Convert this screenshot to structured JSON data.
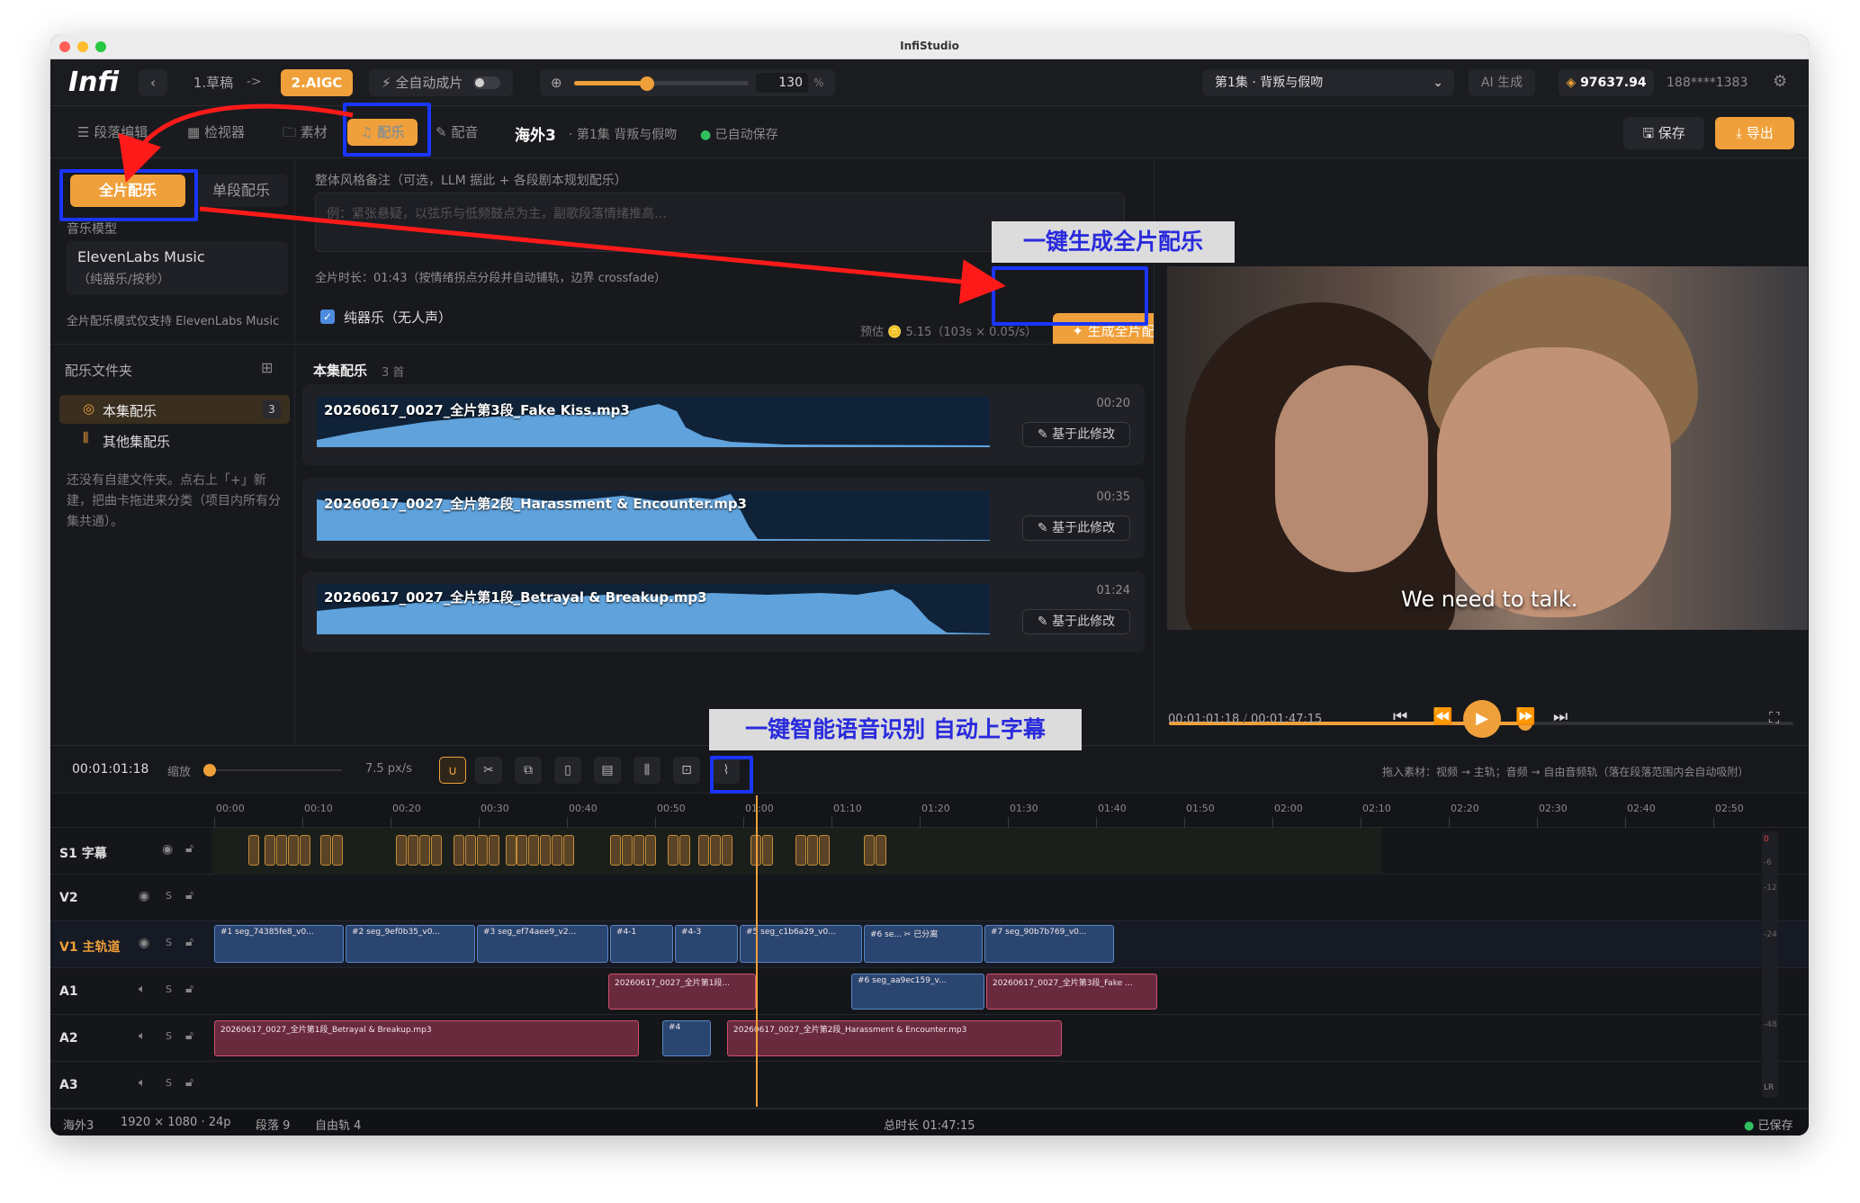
{
  "window": {
    "title": "InfiStudio"
  },
  "topbar": {
    "logo": "Infi",
    "back_icon": "chevron-left-icon",
    "step1": "1.草稿",
    "arrow": "->",
    "step2": "2.AIGC",
    "auto_label": "全自动成片",
    "zoom_value": "130",
    "zoom_unit": "%",
    "zoom_level": 0.42,
    "episode_select": "第1集 · 背叛与假吻",
    "ai_btn": "AI 生成",
    "credits": "97637.94",
    "user": "188****1383",
    "accent": "#f0a03a"
  },
  "toolbar": {
    "tabs": [
      {
        "label": "段落编辑",
        "icon": "list-icon"
      },
      {
        "label": "检视器",
        "icon": "grid-icon"
      },
      {
        "label": "素材",
        "icon": "folder-icon"
      },
      {
        "label": "配乐",
        "icon": "music-icon"
      },
      {
        "label": "配音",
        "icon": "pen-icon"
      }
    ],
    "project": "海外3",
    "crumb": "· 第1集 背叛与假吻",
    "saved_status": "已自动保存",
    "save": "保存",
    "export": "导出"
  },
  "music_panel": {
    "full_tab": "全片配乐",
    "single_tab": "单段配乐",
    "model_label": "音乐模型",
    "model_name": "ElevenLabs Music",
    "model_sub": "（纯器乐/按秒）",
    "model_note": "全片配乐模式仅支持 ElevenLabs Music",
    "style_label": "整体风格备注（可选，LLM 据此 + 各段剧本规划配乐）",
    "style_placeholder": "例：紧张悬疑，以弦乐与低频鼓点为主，副歌段落情绪推高…",
    "duration_note": "全片时长：01:43（按情绪拐点分段并自动铺轨，边界 crossfade）",
    "estimate": "预估 🪙 5.15（103s × 0.05/s）",
    "instrumental": "纯器乐（无人声）",
    "generate": "生成全片配乐"
  },
  "folders": {
    "title": "配乐文件夹",
    "items": [
      {
        "label": "本集配乐",
        "count": "3"
      },
      {
        "label": "其他集配乐",
        "count": ""
      }
    ],
    "hint": "还没有自建文件夹。点右上「+」新建，把曲卡拖进来分类（项目内所有分集共通）。"
  },
  "library": {
    "title": "本集配乐",
    "count": "3 首",
    "modify_label": "基于此修改",
    "tracks": [
      {
        "name": "20260617_0027_全片第3段_Fake Kiss.mp3",
        "duration": "00:20"
      },
      {
        "name": "20260617_0027_全片第2段_Harassment & Encounter.mp3",
        "duration": "00:35"
      },
      {
        "name": "20260617_0027_全片第1段_Betrayal & Breakup.mp3",
        "duration": "01:24"
      }
    ]
  },
  "preview": {
    "subtitle": "We need to talk.",
    "current": "00:01:01:18",
    "sep": "/",
    "total": "00:01:47:15",
    "progress": 0.57
  },
  "callouts": {
    "gen_music": "一键生成全片配乐",
    "asr": "一键智能语音识别 自动上字幕"
  },
  "timeline": {
    "timecode": "00:01:01:18",
    "zoom_label": "缩放",
    "px_per_s": "7.5 px/s",
    "hint": "拖入素材：视频 → 主轨；音频 → 自由音频轨（落在段落范围内会自动吸附）",
    "ruler": [
      "00:00",
      "00:10",
      "00:20",
      "00:30",
      "00:40",
      "00:50",
      "01:00",
      "01:10",
      "01:20",
      "01:30",
      "01:40",
      "01:50",
      "02:00",
      "02:10",
      "02:20",
      "02:30",
      "02:40",
      "02:50"
    ],
    "tracks": [
      "S1 字幕",
      "V2",
      "V1 主轨道",
      "A1",
      "A2",
      "A3"
    ],
    "solo": "S",
    "v1_clips": [
      {
        "label": "#1 seg_74385fe8_v0..."
      },
      {
        "label": "#2 seg_9ef0b35_v0..."
      },
      {
        "label": "#3 seg_ef74aee9_v2..."
      },
      {
        "label": "#4-1"
      },
      {
        "label": "#4-3"
      },
      {
        "label": "#5 seg_c1b6a29_v0..."
      },
      {
        "label": "#6 se... ✂ 已分离"
      },
      {
        "label": "#7 seg_90b7b769_v0..."
      }
    ],
    "a1_clips": [
      {
        "label": "20260617_0027_全片第1段..."
      },
      {
        "label": "#6 seg_aa9ec159_v..."
      },
      {
        "label": "20260617_0027_全片第3段_Fake ..."
      }
    ],
    "a2_clips": [
      {
        "label": "20260617_0027_全片第1段_Betrayal & Breakup.mp3"
      },
      {
        "label": "#4"
      },
      {
        "label": "20260617_0027_全片第2段_Harassment & Encounter.mp3"
      }
    ],
    "meter_labels": [
      "0",
      "-6",
      "-12",
      "-24",
      "-48",
      "LR"
    ]
  },
  "statusbar": {
    "project": "海外3",
    "format": "1920 × 1080 · 24p",
    "segments": "段落 9",
    "free_tracks": "自由轨 4",
    "total": "总时长 01:47:15",
    "saved": "已保存"
  }
}
